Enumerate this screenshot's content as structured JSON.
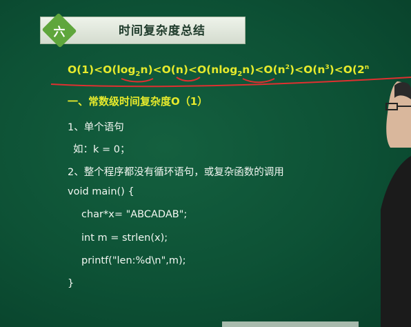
{
  "slide": {
    "badge": "六",
    "title": "时间复杂度总结",
    "complexity_order": {
      "o1": "O(1)",
      "lt": "<",
      "olog_pre": "O(log",
      "olog_sub": "2",
      "olog_post": "n)",
      "on": "O(n)",
      "onlog_pre": "O(nlog",
      "onlog_sub": "2",
      "onlog_post": "n)",
      "on2_pre": "O(n",
      "on2_sup": "2",
      "on2_post": ")",
      "on3_pre": "O(n",
      "on3_sup": "3",
      "on3_post": ")",
      "o2n_pre": "O(2",
      "o2n_sup": "n"
    },
    "section_heading": "一、常数级时间复杂度O（1）",
    "lines": [
      "1、单个语句",
      "如：k = 0；",
      "2、整个程序都没有循环语句，或复杂函数的调用",
      "void main() {",
      "char*x= \"ABCADAB\";",
      "int m = strlen(x);",
      "printf(\"len:%d\\n\",m);",
      "}"
    ]
  },
  "colors": {
    "board": "#0d5135",
    "accent_yellow": "#e6ea2c",
    "badge_green": "#5fa63c",
    "annotation_red": "#e03030"
  }
}
